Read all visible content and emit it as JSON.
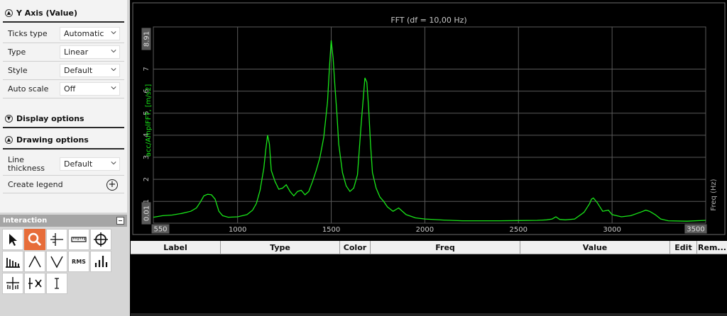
{
  "y_axis_section": {
    "title": "Y Axis (Value)",
    "rows": [
      {
        "label": "Ticks type",
        "value": "Automatic"
      },
      {
        "label": "Type",
        "value": "Linear"
      },
      {
        "label": "Style",
        "value": "Default"
      },
      {
        "label": "Auto scale",
        "value": "Off"
      }
    ]
  },
  "display_options": {
    "title": "Display options"
  },
  "drawing_options": {
    "title": "Drawing options",
    "line_thickness": {
      "label": "Line thickness",
      "value": "Default"
    },
    "create_legend": {
      "label": "Create legend"
    }
  },
  "interaction": {
    "title": "Interaction",
    "tools": [
      "pointer-icon",
      "zoom-icon",
      "cursor-icon",
      "ruler-icon",
      "crosshair-icon",
      "harmonic-icon",
      "peak-up-icon",
      "peak-down-icon",
      "rms-icon",
      "bar-cursor-icon",
      "band-icon",
      "split-icon",
      "text-cursor-icon"
    ],
    "rms_label": "RMS",
    "active_tool": "zoom-icon"
  },
  "colors": {
    "trace": "#19e619",
    "grid": "#5a5a5a",
    "axis_label": "#19e619",
    "active_tool": "#e76d3a"
  },
  "chart_data": {
    "type": "line",
    "title": "FFT (df = 10,00 Hz)",
    "ylabel": "acc/AmplFFT, [m/s2]",
    "xlabel": "Freq (Hz)",
    "xlim": [
      550,
      3500
    ],
    "ylim": [
      0.01,
      8.91
    ],
    "x_ticks": [
      "1000",
      "1500",
      "2000",
      "2500",
      "3000"
    ],
    "x_range_labels": {
      "min": "550",
      "max": "3500"
    },
    "y_ticks": [
      "1",
      "2",
      "3",
      "4",
      "5",
      "6",
      "7"
    ],
    "y_range_labels": {
      "min": "0.01",
      "max": "8.91"
    },
    "grid": true,
    "series": [
      {
        "x": [
          550,
          600,
          650,
          700,
          750,
          780,
          800,
          820,
          840,
          860,
          880,
          900,
          920,
          950,
          1000,
          1050,
          1080,
          1100,
          1120,
          1140,
          1150,
          1160,
          1170,
          1180,
          1200,
          1220,
          1240,
          1260,
          1280,
          1300,
          1320,
          1340,
          1360,
          1380,
          1400,
          1420,
          1440,
          1460,
          1480,
          1490,
          1500,
          1510,
          1520,
          1530,
          1540,
          1560,
          1580,
          1600,
          1620,
          1640,
          1660,
          1680,
          1690,
          1700,
          1710,
          1720,
          1740,
          1760,
          1780,
          1800,
          1830,
          1860,
          1900,
          1950,
          2000,
          2100,
          2200,
          2300,
          2400,
          2500,
          2600,
          2650,
          2680,
          2700,
          2720,
          2750,
          2800,
          2850,
          2880,
          2890,
          2900,
          2920,
          2950,
          2980,
          3000,
          3050,
          3100,
          3150,
          3180,
          3200,
          3230,
          3260,
          3300,
          3400,
          3500
        ],
        "y": [
          0.28,
          0.35,
          0.38,
          0.45,
          0.55,
          0.7,
          0.95,
          1.25,
          1.32,
          1.3,
          1.1,
          0.55,
          0.35,
          0.28,
          0.3,
          0.4,
          0.6,
          0.9,
          1.5,
          2.5,
          3.3,
          4.0,
          3.6,
          2.4,
          1.9,
          1.55,
          1.6,
          1.75,
          1.45,
          1.25,
          1.45,
          1.5,
          1.3,
          1.45,
          1.9,
          2.4,
          3.0,
          3.9,
          5.5,
          7.0,
          8.3,
          7.5,
          6.2,
          5.0,
          3.6,
          2.3,
          1.7,
          1.45,
          1.6,
          2.2,
          4.5,
          6.6,
          6.4,
          5.2,
          3.6,
          2.3,
          1.6,
          1.2,
          1.0,
          0.75,
          0.55,
          0.7,
          0.4,
          0.25,
          0.2,
          0.15,
          0.12,
          0.12,
          0.12,
          0.13,
          0.14,
          0.16,
          0.2,
          0.3,
          0.18,
          0.16,
          0.2,
          0.5,
          0.9,
          1.1,
          1.15,
          0.95,
          0.55,
          0.6,
          0.4,
          0.3,
          0.35,
          0.5,
          0.6,
          0.55,
          0.4,
          0.2,
          0.12,
          0.1,
          0.14
        ]
      }
    ]
  },
  "table": {
    "columns": [
      "Label",
      "Type",
      "Color",
      "Freq",
      "Value",
      "Edit",
      "Rem..."
    ]
  }
}
